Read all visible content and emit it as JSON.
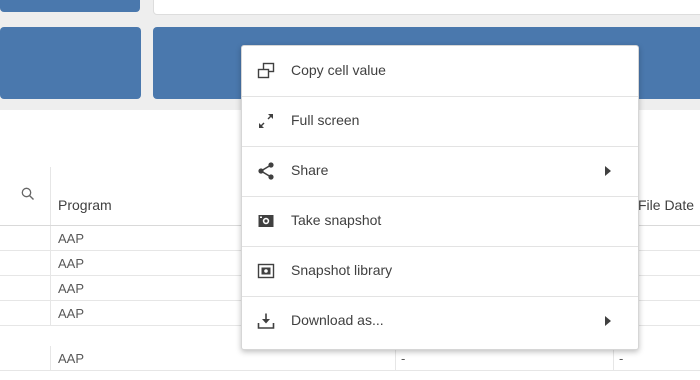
{
  "table": {
    "columns": {
      "program": "Program",
      "file_date": "File Date"
    },
    "rows": [
      {
        "program": "AAP",
        "mid": "",
        "right": ""
      },
      {
        "program": "AAP",
        "mid": "",
        "right": ""
      },
      {
        "program": "AAP",
        "mid": "",
        "right": ""
      },
      {
        "program": "AAP",
        "mid": "",
        "right": ""
      },
      {
        "program": "AAP",
        "mid": "-",
        "right": "-"
      }
    ]
  },
  "context_menu": {
    "items": [
      {
        "label": "Copy cell value",
        "icon": "copy-icon",
        "submenu": false
      },
      {
        "label": "Full screen",
        "icon": "expand-icon",
        "submenu": false
      },
      {
        "label": "Share",
        "icon": "share-icon",
        "submenu": true
      },
      {
        "label": "Take snapshot",
        "icon": "camera-icon",
        "submenu": false
      },
      {
        "label": "Snapshot library",
        "icon": "snapshot-library-icon",
        "submenu": false
      },
      {
        "label": "Download as...",
        "icon": "download-icon",
        "submenu": true
      }
    ]
  },
  "colors": {
    "tile": "#4a78ad",
    "panel": "#eeeeee",
    "icon": "#404040"
  }
}
